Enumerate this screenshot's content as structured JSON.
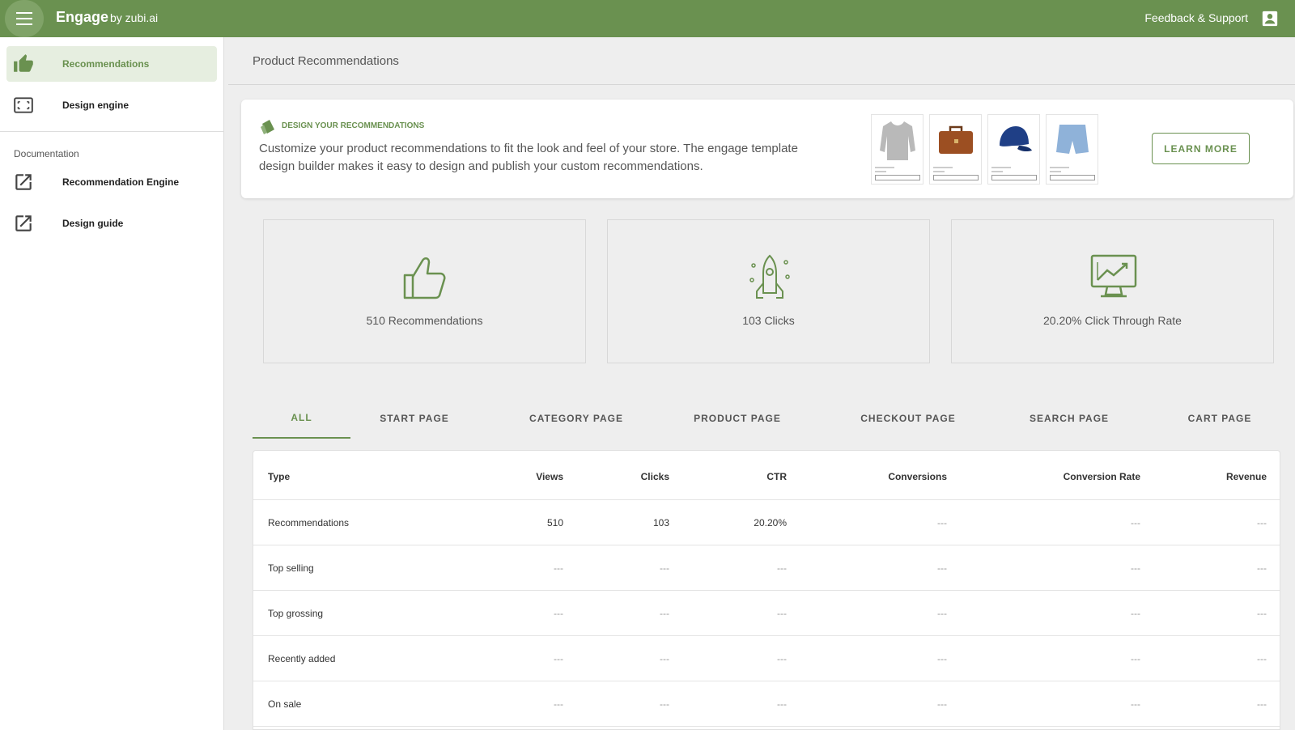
{
  "topbar": {
    "brand": "Engage",
    "brand_sub": "by zubi.ai",
    "feedback": "Feedback & Support",
    "menu_icon": "hamburger-icon",
    "account_icon": "account-box-icon"
  },
  "sidebar": {
    "items": [
      {
        "label": "Recommendations",
        "icon": "thumb-up-icon",
        "active": true
      },
      {
        "label": "Design engine",
        "icon": "design-frame-icon"
      }
    ],
    "section_label": "Documentation",
    "doc_items": [
      {
        "label": "Recommendation Engine",
        "icon": "open-in-new-icon"
      },
      {
        "label": "Design guide",
        "icon": "open-in-new-icon"
      }
    ]
  },
  "main": {
    "page_title": "Product Recommendations",
    "banner": {
      "heading": "DESIGN YOUR RECOMMENDATIONS",
      "text": "Customize your product recommendations to fit the look and feel of your store. The engage template design builder makes it easy to design and publish your custom recommendations.",
      "button": "LEARN MORE",
      "thumbnails": [
        "sweater",
        "briefcase",
        "cap",
        "shorts"
      ]
    },
    "stats": [
      {
        "label": "510 Recommendations",
        "icon": "thumb-up-outline-icon"
      },
      {
        "label": "103 Clicks",
        "icon": "rocket-icon"
      },
      {
        "label": "20.20% Click Through Rate",
        "icon": "monitor-chart-icon"
      }
    ],
    "tabs": [
      "ALL",
      "START PAGE",
      "CATEGORY PAGE",
      "PRODUCT PAGE",
      "CHECKOUT PAGE",
      "SEARCH PAGE",
      "CART PAGE"
    ],
    "active_tab": "ALL",
    "table": {
      "columns": [
        "Type",
        "Views",
        "Clicks",
        "CTR",
        "Conversions",
        "Conversion Rate",
        "Revenue"
      ],
      "rows": [
        [
          "Recommendations",
          "510",
          "103",
          "20.20%",
          "---",
          "---",
          "---"
        ],
        [
          "Top selling",
          "---",
          "---",
          "---",
          "---",
          "---",
          "---"
        ],
        [
          "Top grossing",
          "---",
          "---",
          "---",
          "---",
          "---",
          "---"
        ],
        [
          "Recently added",
          "---",
          "---",
          "---",
          "---",
          "---",
          "---"
        ],
        [
          "On sale",
          "---",
          "---",
          "---",
          "---",
          "---",
          "---"
        ]
      ]
    }
  },
  "colors": {
    "accent": "#6a9150",
    "active_bg": "#e6eee0"
  }
}
